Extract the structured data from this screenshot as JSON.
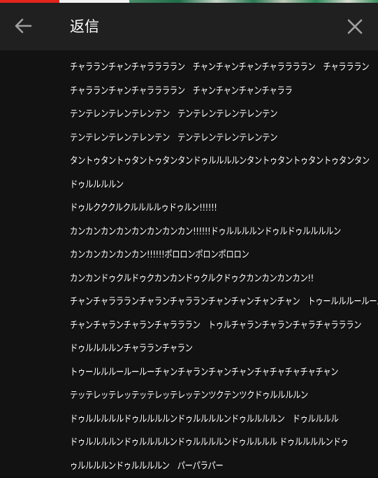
{
  "header": {
    "title": "返信",
    "back_icon": "arrow-left-icon",
    "close_icon": "close-icon"
  },
  "colors": {
    "header_bg": "#202020",
    "content_bg": "#121212",
    "text": "#ffffff",
    "icon": "#9e9e9e"
  },
  "reply": {
    "lines": [
      "チャラランチャンチャララララン　チャンチャンチャンチャララララン　チャラララン",
      "チャラランチャンチャララララン　チャンチャンチャンチャララ",
      "テンテレンテレンテレンテン　テンテレンテレンテレンテン",
      "テンテレンテレンテレンテン　テンテレンテレンテレンテン",
      "タントゥタントゥタントゥタンタンドゥルルルルンタントゥタントゥタントゥタンタン",
      "ドゥルルルルン",
      "ドゥルクククルクルルルルゥドゥルン!!!!!!",
      "カンカンカンカンカンカンカンカン!!!!!!ドゥルルルルンドゥルドゥルルルルン",
      "カンカンカンカンカン!!!!!!ポロロンポロンポロロン",
      "カンカンドゥクルドゥクカンカンドゥクルクドゥクカンカンカンカン!!",
      "チャンチャララランチャランチャラランチャンチャンチャンチャン　トゥールルルールールー",
      "チャンチャランチャランチャラララン　トゥルチャランチャランチャラチャラララン",
      "ドゥルルルルンチャラランチャラン",
      "トゥールルルールールーチャンチャランチャンチャンチャチャチャチャチャン",
      "テッテレッテレッテッテレッテレッテンツクテンツクドゥルルルルン",
      "ドゥルルルルルドゥルルルルンドゥルルルルンドゥルルルルン　ドゥルルルル",
      "ドゥルルルルンドゥルルルルンドゥルルルルンドゥルルルル ドゥルルルルンドゥ",
      "ゥルルルルンドゥルルルルン　パーパラパー"
    ]
  }
}
